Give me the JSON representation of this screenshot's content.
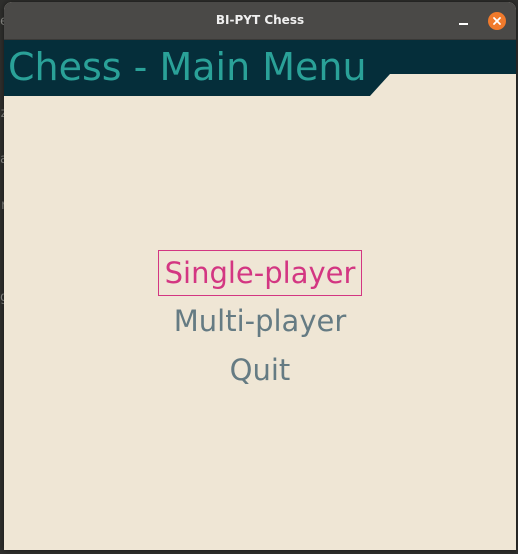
{
  "window": {
    "title": "BI-PYT Chess",
    "controls": {
      "minimize_icon": "minimize-icon",
      "close_icon": "close-icon",
      "close_color": "#f07a2c"
    }
  },
  "banner": {
    "title": "Chess - Main Menu",
    "background_color": "#052e3a",
    "text_color": "#2aa198"
  },
  "menu": {
    "items": [
      {
        "label": "Single-player",
        "selected": true
      },
      {
        "label": "Multi-player",
        "selected": false
      },
      {
        "label": "Quit",
        "selected": false
      }
    ],
    "selected_color": "#d33682",
    "item_color": "#657b83"
  },
  "colors": {
    "background": "#efe6d5",
    "titlebar": "#4a4947"
  }
}
